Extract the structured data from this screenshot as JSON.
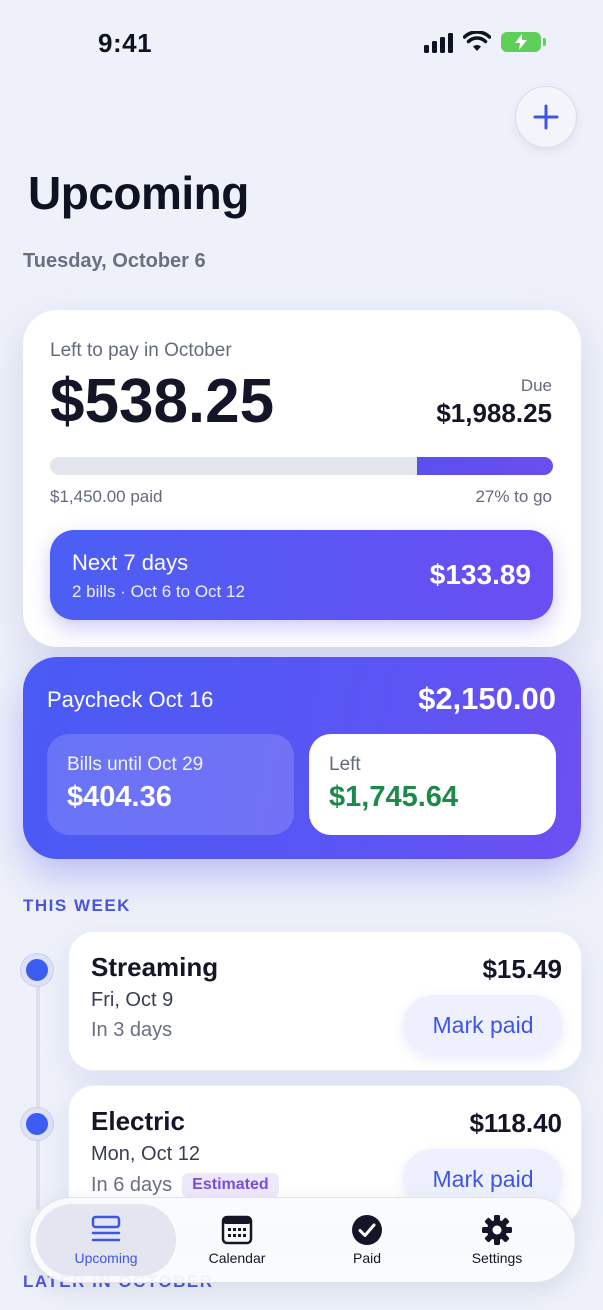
{
  "status_bar": {
    "time": "9:41"
  },
  "header": {
    "title": "Upcoming",
    "date": "Tuesday, October 6"
  },
  "summary": {
    "label": "Left to pay in October",
    "amount": "$538.25",
    "due_label": "Due",
    "due_amount": "$1,988.25",
    "paid_fraction": 0.73,
    "paid_text": "$1,450.00 paid",
    "to_go_text": "27% to go",
    "next_days": {
      "title": "Next 7 days",
      "subtitle": "2 bills · Oct 6 to Oct 12",
      "amount": "$133.89"
    }
  },
  "paycheck": {
    "title": "Paycheck Oct 16",
    "amount": "$2,150.00",
    "bills_label": "Bills until Oct 29",
    "bills_amount": "$404.36",
    "left_label": "Left",
    "left_amount": "$1,745.64"
  },
  "sections": {
    "this_week": "THIS WEEK",
    "later": "LATER IN OCTOBER"
  },
  "bills": [
    {
      "name": "Streaming",
      "date": "Fri, Oct 9",
      "relative": "In 3 days",
      "amount": "$15.49",
      "action": "Mark paid"
    },
    {
      "name": "Electric",
      "date": "Mon, Oct 12",
      "relative": "In 6 days",
      "badge": "Estimated",
      "amount": "$118.40",
      "action": "Mark paid"
    }
  ],
  "tabs": [
    {
      "label": "Upcoming",
      "icon": "list-icon",
      "active": true
    },
    {
      "label": "Calendar",
      "icon": "calendar-icon"
    },
    {
      "label": "Paid",
      "icon": "checkmark-circle-icon"
    },
    {
      "label": "Settings",
      "icon": "gear-icon"
    }
  ],
  "colors": {
    "accent": "#4a5bf5",
    "positive": "#1b8a4b",
    "background": "#eef1f9"
  }
}
